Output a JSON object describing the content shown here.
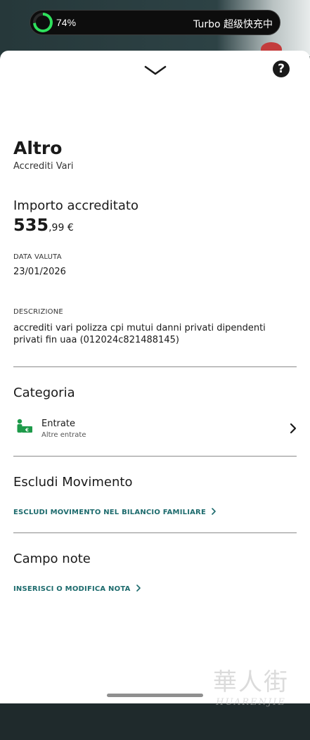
{
  "status_bar": {
    "battery_percent_label": "74%",
    "battery_level": 0.74,
    "charging_label": "Turbo 超级快充中",
    "ring_color": "#2ee05c"
  },
  "sheet": {
    "collapse_icon": "chevron-down-icon",
    "help_icon": "question-circle-icon",
    "help_symbol": "?"
  },
  "transaction": {
    "title": "Altro",
    "subtitle": "Accrediti Vari",
    "amount_label": "Importo accreditato",
    "amount_integer": "535",
    "amount_decimal": ",99",
    "amount_currency": " €",
    "value_date_label": "DATA VALUTA",
    "value_date": "23/01/2026",
    "description_label": "DESCRIZIONE",
    "description": "accrediti vari polizza cpi mutui danni privati dipendenti privati fin uaa (012024c821488145)"
  },
  "category": {
    "section_title": "Categoria",
    "icon": "cash-icon",
    "name": "Entrate",
    "sub": "Altre entrate"
  },
  "exclude": {
    "section_title": "Escludi Movimento",
    "link_label": "ESCLUDI MOVIMENTO NEL BILANCIO FAMILIARE"
  },
  "notes": {
    "section_title": "Campo note",
    "link_label": "INSERISCI O MODIFICA NOTA"
  },
  "watermark": {
    "text_cn": "華人街",
    "text_en": "HUARENJIE"
  },
  "colors": {
    "accent_teal": "#1d6b6d",
    "icon_green": "#1e9a4a"
  }
}
